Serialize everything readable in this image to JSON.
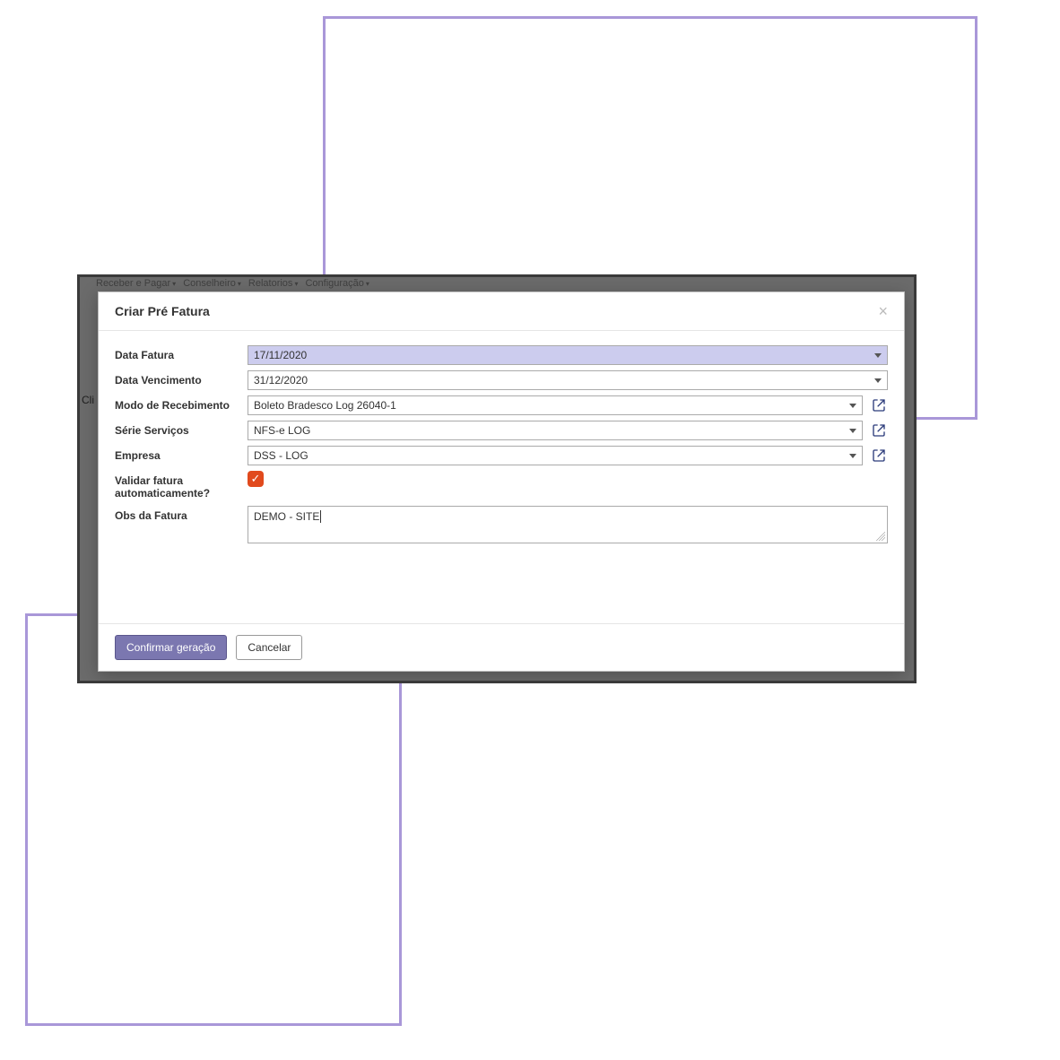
{
  "menu": {
    "items": [
      "Receber e Pagar",
      "Conselheiro",
      "Relatorios",
      "Configuração"
    ]
  },
  "bgText": "Cli",
  "modal": {
    "title": "Criar Pré Fatura",
    "labels": {
      "dataFatura": "Data Fatura",
      "dataVencimento": "Data Vencimento",
      "modoRecebimento": "Modo de Recebimento",
      "serieServicos": "Série Serviços",
      "empresa": "Empresa",
      "validarAuto": "Validar fatura automaticamente?",
      "obsFatura": "Obs da Fatura"
    },
    "values": {
      "dataFatura": "17/11/2020",
      "dataVencimento": "31/12/2020",
      "modoRecebimento": "Boleto Bradesco Log 26040-1",
      "serieServicos": "NFS-e LOG",
      "empresa": "DSS - LOG",
      "validarAuto": true,
      "obsFatura": "DEMO - SITE"
    },
    "buttons": {
      "confirm": "Confirmar geração",
      "cancel": "Cancelar"
    }
  }
}
